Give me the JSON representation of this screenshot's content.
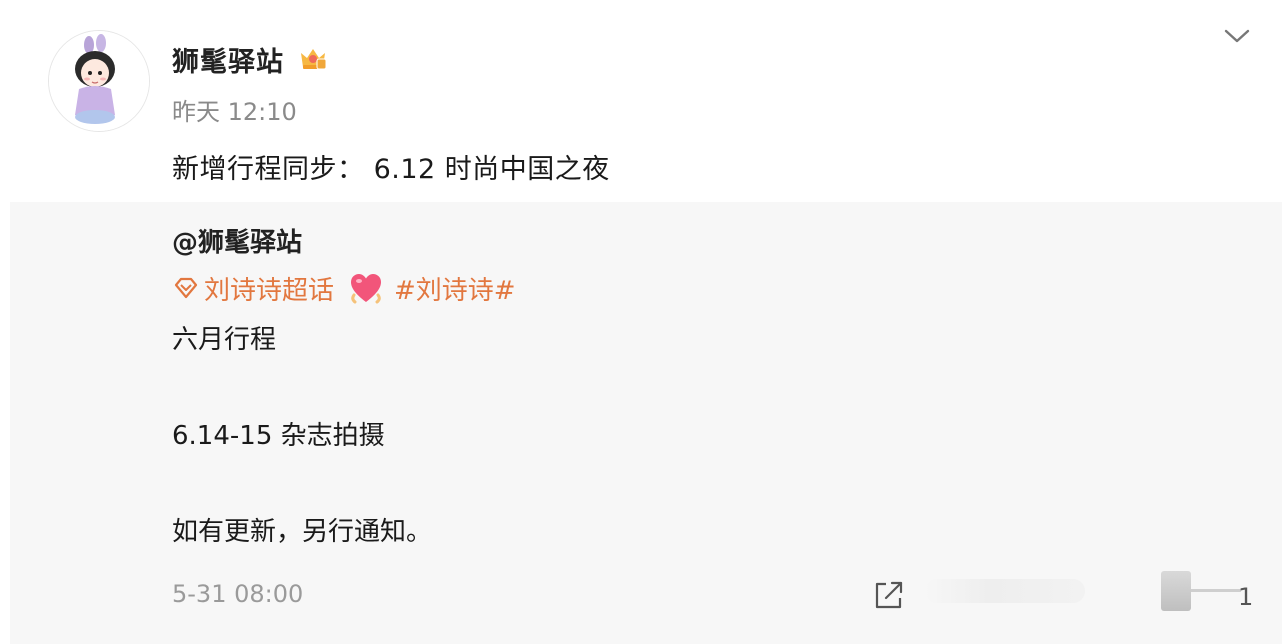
{
  "post": {
    "username": "狮髦驿站",
    "time": "昨天 12:10",
    "text": "新增行程同步： 6.12 时尚中国之夜"
  },
  "repost": {
    "author": "@狮髦驿站",
    "supertopic": "刘诗诗超话",
    "hashtag": "#刘诗诗#",
    "lines": [
      "六月行程",
      "6.14-15 杂志拍摄",
      "如有更新，另行通知。"
    ],
    "time": "5-31 08:00",
    "count": "1"
  },
  "icons": {
    "vip": "crown-badge-icon",
    "menu": "chevron-down-icon",
    "supertopic": "diamond-icon",
    "emoji": "heart-emoji-icon",
    "share": "share-icon"
  },
  "colors": {
    "tag": "#e2773f",
    "muted": "#8a8a8a",
    "repost_bg": "#f7f7f7"
  }
}
